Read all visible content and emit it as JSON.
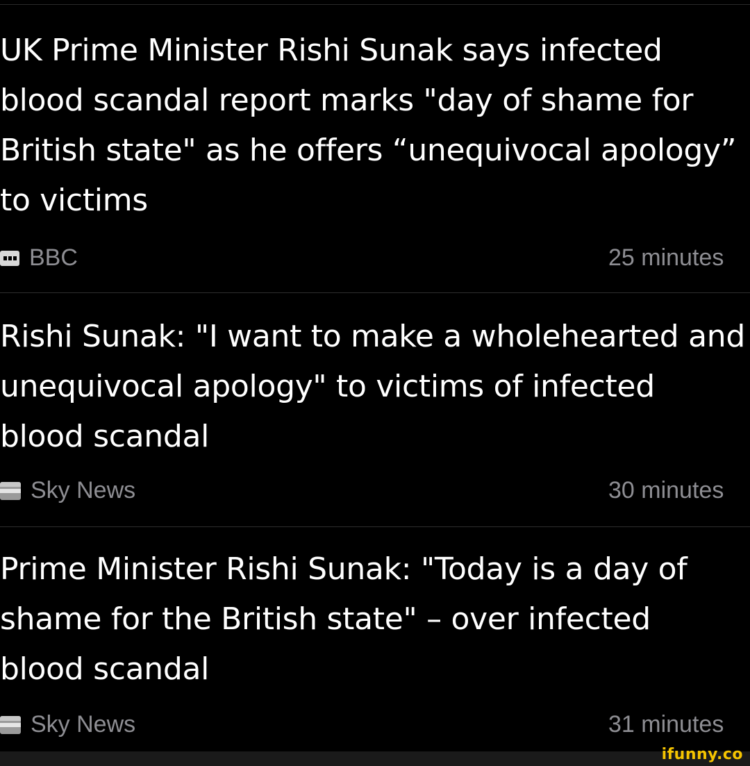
{
  "feed": {
    "items": [
      {
        "headline_lines": [
          "UK Prime Minister Rishi Sunak says infected",
          "blood scandal report marks \"day of shame for",
          "British state\" as he offers “unequivocal apology”",
          "to victims"
        ],
        "source": "BBC",
        "source_icon": "bbc-logo-icon",
        "time": "25 minutes"
      },
      {
        "headline_lines": [
          "Rishi Sunak: \"I want to make a wholehearted and",
          "unequivocal apology\" to victims of infected",
          "blood scandal"
        ],
        "source": "Sky News",
        "source_icon": "sky-news-logo-icon",
        "time": "30 minutes"
      },
      {
        "headline_lines": [
          "Prime Minister Rishi Sunak: \"Today is a day of",
          "shame for the British state\" – over infected",
          "blood scandal"
        ],
        "source": "Sky News",
        "source_icon": "sky-news-logo-icon",
        "time": "31 minutes"
      }
    ]
  },
  "watermark": "ifunny.co",
  "colors": {
    "background": "#000000",
    "headline_text": "#ffffff",
    "meta_text": "#8e8e93",
    "divider": "#2e2e2e",
    "watermark": "#f5c400"
  }
}
